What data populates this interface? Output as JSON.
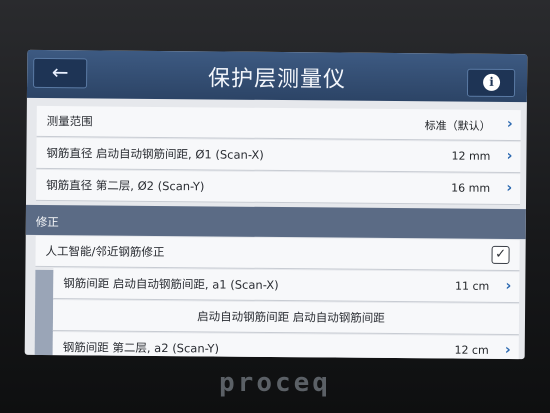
{
  "header": {
    "back_icon": "arrow-left-icon",
    "back_glyph": "←",
    "title": "保护层测量仪",
    "info_glyph": "i",
    "info_icon": "info-icon"
  },
  "settings": {
    "rows": [
      {
        "label": "测量范围",
        "value": "标准（默认）"
      },
      {
        "label": "钢筋直径 启动自动钢筋间距, Ø1 (Scan-X)",
        "value": "12 mm"
      },
      {
        "label": "钢筋直径 第二层, Ø2 (Scan-Y)",
        "value": "16 mm"
      }
    ]
  },
  "correction": {
    "section_label": "修正",
    "ai_label": "人工智能/邻近钢筋修正",
    "ai_checked_glyph": "✓",
    "rows": [
      {
        "label": "钢筋间距 启动自动钢筋间距, a1 (Scan-X)",
        "value": "11 cm"
      },
      {
        "label": "启动自动钢筋间距 启动自动钢筋间距",
        "value": ""
      },
      {
        "label": "钢筋间距 第二层, a2 (Scan-Y)",
        "value": "12 cm"
      }
    ]
  },
  "chevron_glyph": "›",
  "brand": "proceq",
  "colors": {
    "header": "#34507a",
    "accent": "#2c69b0",
    "section": "#5b6b85",
    "row_bg": "#f7f8fa"
  }
}
